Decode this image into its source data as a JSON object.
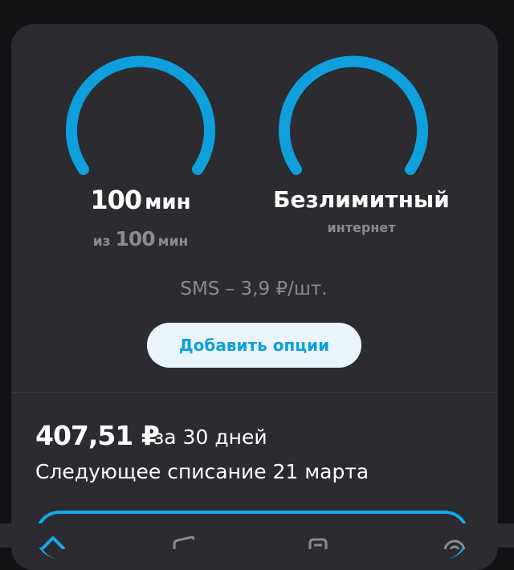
{
  "colors": {
    "accent": "#0f9fdc",
    "card_bg": "#2b2b30",
    "page_bg": "#121214",
    "muted": "#8a8a90"
  },
  "minutes": {
    "value": "100",
    "unit": "мин",
    "from_prefix": "из",
    "total": "100",
    "total_unit": "мин",
    "fill_fraction": 1.0
  },
  "internet": {
    "value": "Безлимитный",
    "label": "интернет",
    "fill_fraction": 1.0
  },
  "sms": {
    "text": "SMS – 3,9 ₽/шт."
  },
  "add_options": {
    "label": "Добавить опции"
  },
  "billing": {
    "price": "407,51 ₽",
    "period": "за 30 дней",
    "next_charge": "Следующее списание 21 марта"
  },
  "tabbar": {
    "icons": [
      "home-icon",
      "wallet-icon",
      "services-icon",
      "support-icon"
    ]
  }
}
